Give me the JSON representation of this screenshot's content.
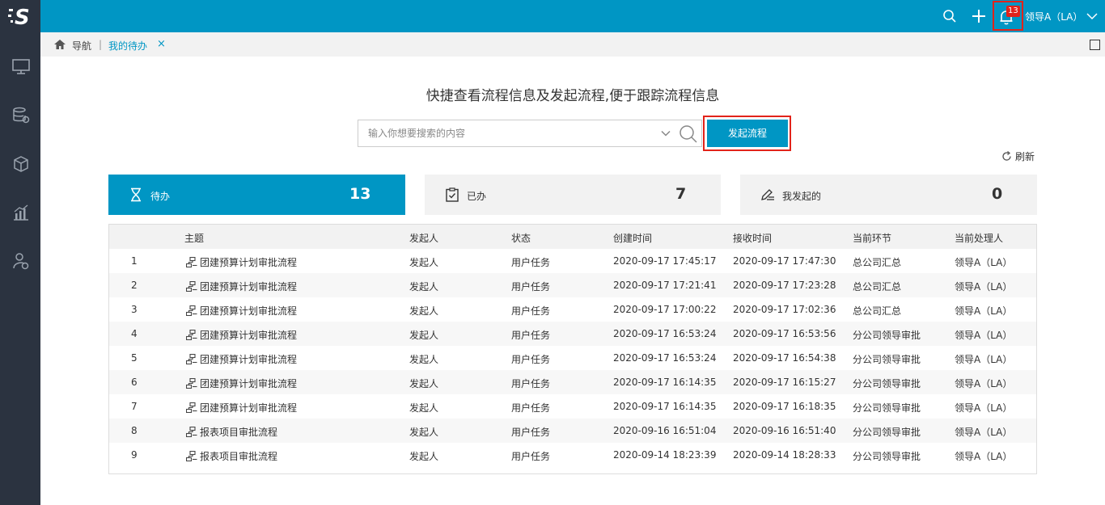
{
  "brand": {
    "logo_letter": "S"
  },
  "topbar": {
    "notification_count": "13",
    "user_name": "领导A（LA）"
  },
  "breadcrumb": {
    "nav_label": "导航",
    "separator": "|",
    "tab_label": "我的待办",
    "close_glyph": "×"
  },
  "main": {
    "headline": "快捷查看流程信息及发起流程,便于跟踪流程信息",
    "search_placeholder": "输入你想要搜索的内容",
    "launch_button": "发起流程",
    "refresh_label": "刷新"
  },
  "cards": [
    {
      "label": "待办",
      "count": "13",
      "icon": "hourglass-icon"
    },
    {
      "label": "已办",
      "count": "7",
      "icon": "clipboard-check-icon"
    },
    {
      "label": "我发起的",
      "count": "0",
      "icon": "edit-list-icon"
    }
  ],
  "table": {
    "headers": [
      "主题",
      "发起人",
      "状态",
      "创建时间",
      "接收时间",
      "当前环节",
      "当前处理人"
    ],
    "rows": [
      {
        "no": "1",
        "subject": "团建预算计划审批流程",
        "initiator": "发起人",
        "status": "用户任务",
        "created": "2020-09-17 17:45:17",
        "received": "2020-09-17 17:47:30",
        "stage": "总公司汇总",
        "handler": "领导A（LA）"
      },
      {
        "no": "2",
        "subject": "团建预算计划审批流程",
        "initiator": "发起人",
        "status": "用户任务",
        "created": "2020-09-17 17:21:41",
        "received": "2020-09-17 17:23:28",
        "stage": "总公司汇总",
        "handler": "领导A（LA）"
      },
      {
        "no": "3",
        "subject": "团建预算计划审批流程",
        "initiator": "发起人",
        "status": "用户任务",
        "created": "2020-09-17 17:00:22",
        "received": "2020-09-17 17:02:36",
        "stage": "总公司汇总",
        "handler": "领导A（LA）"
      },
      {
        "no": "4",
        "subject": "团建预算计划审批流程",
        "initiator": "发起人",
        "status": "用户任务",
        "created": "2020-09-17 16:53:24",
        "received": "2020-09-17 16:53:56",
        "stage": "分公司领导审批",
        "handler": "领导A（LA）"
      },
      {
        "no": "5",
        "subject": "团建预算计划审批流程",
        "initiator": "发起人",
        "status": "用户任务",
        "created": "2020-09-17 16:53:24",
        "received": "2020-09-17 16:54:38",
        "stage": "分公司领导审批",
        "handler": "领导A（LA）"
      },
      {
        "no": "6",
        "subject": "团建预算计划审批流程",
        "initiator": "发起人",
        "status": "用户任务",
        "created": "2020-09-17 16:14:35",
        "received": "2020-09-17 16:15:27",
        "stage": "分公司领导审批",
        "handler": "领导A（LA）"
      },
      {
        "no": "7",
        "subject": "团建预算计划审批流程",
        "initiator": "发起人",
        "status": "用户任务",
        "created": "2020-09-17 16:14:35",
        "received": "2020-09-17 16:18:35",
        "stage": "分公司领导审批",
        "handler": "领导A（LA）"
      },
      {
        "no": "8",
        "subject": "报表项目审批流程",
        "initiator": "发起人",
        "status": "用户任务",
        "created": "2020-09-16 16:51:04",
        "received": "2020-09-16 16:51:40",
        "stage": "分公司领导审批",
        "handler": "领导A（LA）"
      },
      {
        "no": "9",
        "subject": "报表项目审批流程",
        "initiator": "发起人",
        "status": "用户任务",
        "created": "2020-09-14 18:23:39",
        "received": "2020-09-14 18:28:33",
        "stage": "分公司领导审批",
        "handler": "领导A（LA）"
      }
    ]
  },
  "colors": {
    "accent": "#0096c4",
    "sidebar": "#2b3340",
    "highlight": "#e2231a"
  }
}
